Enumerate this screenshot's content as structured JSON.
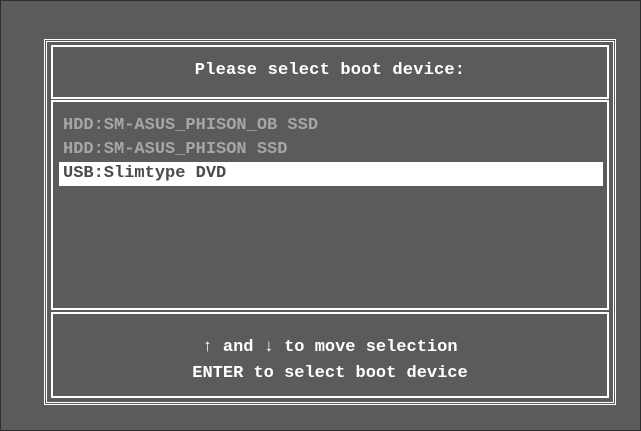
{
  "dialog": {
    "title": "Please select boot device:"
  },
  "devices": [
    {
      "label": "HDD:SM-ASUS_PHISON_OB SSD",
      "selected": false
    },
    {
      "label": "HDD:SM-ASUS_PHISON SSD",
      "selected": false
    },
    {
      "label": "USB:Slimtype DVD",
      "selected": true
    }
  ],
  "footer": {
    "up_arrow": "↑",
    "and_text": " and ",
    "down_arrow": "↓",
    "move_text": " to move selection",
    "enter_line": "ENTER to select boot device"
  },
  "colors": {
    "background": "#5b5b5b",
    "border": "#ffffff",
    "unselected_text": "#a6a6a6",
    "selected_bg": "#ffffff",
    "selected_text": "#4a4a4a"
  },
  "icons": {
    "up": "up-arrow-icon",
    "down": "down-arrow-icon"
  }
}
